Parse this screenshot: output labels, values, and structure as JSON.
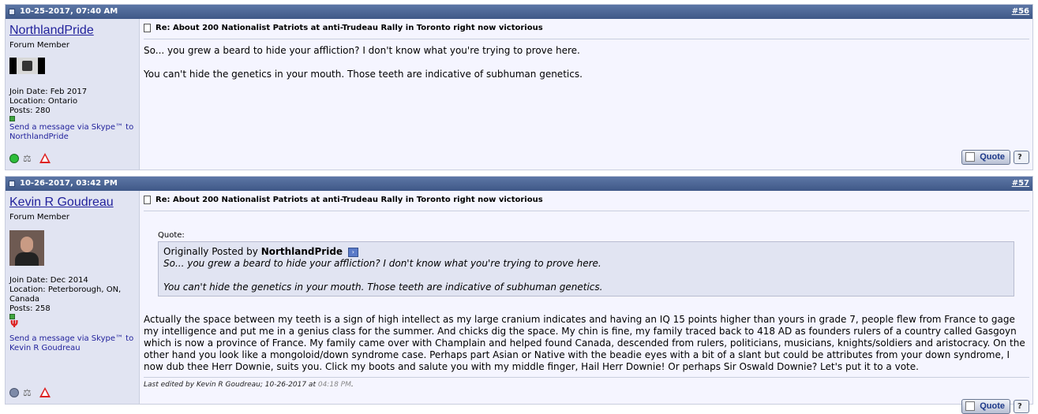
{
  "posts": [
    {
      "date": "10-25-2017, 07:40 AM",
      "number": "#56",
      "username": "NorthlandPride",
      "user_title": "Forum Member",
      "join_date": "Join Date: Feb 2017",
      "location": "Location: Ontario",
      "location_cont": "",
      "posts": "Posts: 280",
      "skype_1": "Send a message via Skype™ to",
      "skype_2": "NorthlandPride",
      "post_title": "Re: About 200 Nationalist Patriots at anti-Trudeau Rally in Toronto right now victorious",
      "body_1": "So... you grew a beard to hide your affliction? I don't know what you're trying to prove here.",
      "body_2": "You can't hide the genetics in your mouth. Those teeth are indicative of subhuman genetics.",
      "quote_button": "Quote"
    },
    {
      "date": "10-26-2017, 03:42 PM",
      "number": "#57",
      "username": "Kevin R Goudreau",
      "user_title": "Forum Member",
      "join_date": "Join Date: Dec 2014",
      "location": "Location: Peterborough, ON,",
      "location_cont": "Canada",
      "posts": "Posts: 258",
      "skype_1": "Send a message via Skype™ to",
      "skype_2": "Kevin R Goudreau",
      "post_title": "Re: About 200 Nationalist Patriots at anti-Trudeau Rally in Toronto right now victorious",
      "quote_label": "Quote:",
      "quote_prefix": "Originally Posted by",
      "quote_author": "NorthlandPride",
      "quote_1": "So... you grew a beard to hide your affliction? I don't know what you're trying to prove here.",
      "quote_2": "You can't hide the genetics in your mouth. Those teeth are indicative of subhuman genetics.",
      "body_lines": [
        "Actually the space between my teeth is a sign of high intellect as my large cranium indicates and having an IQ 15 points higher than yours in grade 7, people flew from France to gage",
        "my intelligence and put me in a genius class for the summer. And chicks dig the space. My chin is fine, my family traced back to 418 AD as founders rulers of a country called Gasgoyn",
        "which is now a province of France. My family came over with Champlain and helped found Canada, descended from rulers, politicians, musicians, knights/soldiers and aristocracy. On the",
        "other hand you look like a mongoloid/down syndrome case. Perhaps part Asian or Native with the beadie eyes with a bit of a slant but could be attributes from your down syndrome, I",
        "now dub thee Herr Downie, suits you. Click my boots and salute you with my middle finger, Hail Herr Downie! Or perhaps Sir Oswald Downie? Let's put it to a vote."
      ],
      "edited_prefix": "Last edited by Kevin R Goudreau; 10-26-2017 at",
      "edited_time": "04:18 PM",
      "edited_suffix": ".",
      "quote_button": "Quote"
    }
  ]
}
